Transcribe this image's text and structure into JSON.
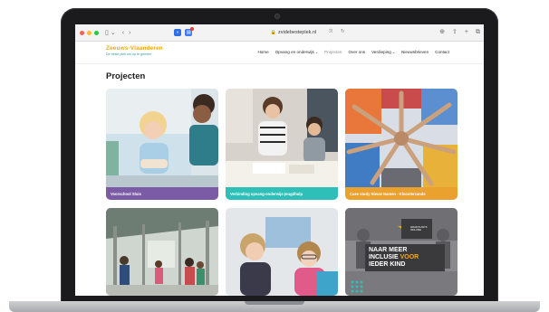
{
  "browser": {
    "url": "zvidebesteplek.nl",
    "reader_label": "ℛ",
    "reload_label": "↻"
  },
  "site": {
    "logo_title": "Zeeuws-Vlaanderen",
    "logo_subtitle": "De beste plek om op te groeien",
    "nav": [
      {
        "label": "Home",
        "has_dropdown": false
      },
      {
        "label": "Opvang en onderwijs",
        "has_dropdown": true
      },
      {
        "label": "Projecten",
        "has_dropdown": false,
        "active": true
      },
      {
        "label": "Over ons",
        "has_dropdown": false
      },
      {
        "label": "Verdieping",
        "has_dropdown": true
      },
      {
        "label": "Nieuwsbrieven",
        "has_dropdown": false
      },
      {
        "label": "Contact",
        "has_dropdown": false
      }
    ]
  },
  "page": {
    "title": "Projecten",
    "cards": [
      {
        "caption": "Voorschool Sluis",
        "color": "#7b5aa6"
      },
      {
        "caption": "Verbinding opvang-onderwijs-jeugdhulp",
        "color": "#2fbfb9"
      },
      {
        "caption": "Case study Nieuw Namen - Kloosterzande",
        "color": "#eaa12e"
      },
      {
        "caption": "",
        "color": ""
      },
      {
        "caption": "",
        "color": ""
      },
      {
        "caption": "",
        "color": ""
      }
    ],
    "poster": {
      "line1": "NAAR MEER",
      "line2a": "INCLUSIE",
      "line2b": "VOOR",
      "line3": "IEDER KIND",
      "logo_text": "WAAR PLANTS INCLUSIE"
    }
  },
  "colors": {
    "brand_orange": "#f0a81c",
    "brand_teal": "#2a9d9a"
  }
}
